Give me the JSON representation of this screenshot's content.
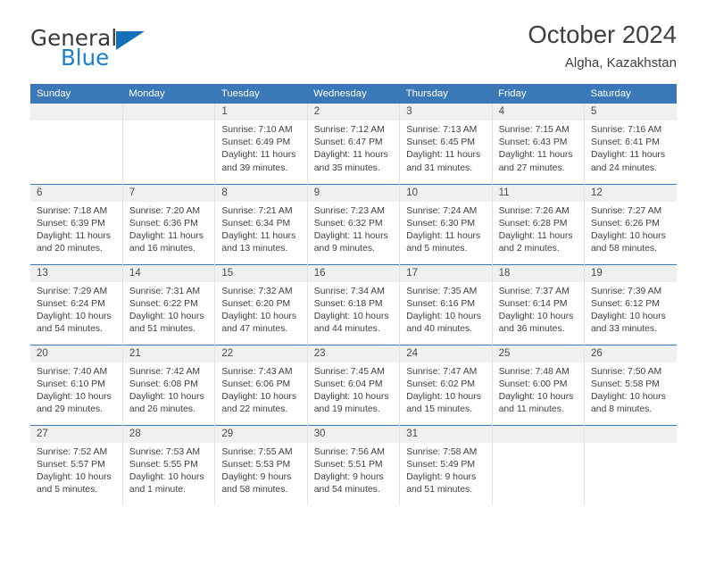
{
  "brand": {
    "word_one": "General",
    "word_two": "Blue",
    "triangle_color": "#1271b8",
    "blue_color": "#1b7fd1"
  },
  "header": {
    "title": "October 2024",
    "subtitle": "Algha, Kazakhstan"
  },
  "theme": {
    "header_blue": "#3b78b7",
    "daynum_background": "#f0f0f0",
    "grid_line": "#e3e3e3",
    "text": "#3f3f3f"
  },
  "weekdays": [
    "Sunday",
    "Monday",
    "Tuesday",
    "Wednesday",
    "Thursday",
    "Friday",
    "Saturday"
  ],
  "weeks": [
    [
      {
        "day": ""
      },
      {
        "day": ""
      },
      {
        "day": "1",
        "sunrise": "Sunrise: 7:10 AM",
        "sunset": "Sunset: 6:49 PM",
        "daylight_1": "Daylight: 11 hours",
        "daylight_2": "and 39 minutes."
      },
      {
        "day": "2",
        "sunrise": "Sunrise: 7:12 AM",
        "sunset": "Sunset: 6:47 PM",
        "daylight_1": "Daylight: 11 hours",
        "daylight_2": "and 35 minutes."
      },
      {
        "day": "3",
        "sunrise": "Sunrise: 7:13 AM",
        "sunset": "Sunset: 6:45 PM",
        "daylight_1": "Daylight: 11 hours",
        "daylight_2": "and 31 minutes."
      },
      {
        "day": "4",
        "sunrise": "Sunrise: 7:15 AM",
        "sunset": "Sunset: 6:43 PM",
        "daylight_1": "Daylight: 11 hours",
        "daylight_2": "and 27 minutes."
      },
      {
        "day": "5",
        "sunrise": "Sunrise: 7:16 AM",
        "sunset": "Sunset: 6:41 PM",
        "daylight_1": "Daylight: 11 hours",
        "daylight_2": "and 24 minutes."
      }
    ],
    [
      {
        "day": "6",
        "sunrise": "Sunrise: 7:18 AM",
        "sunset": "Sunset: 6:39 PM",
        "daylight_1": "Daylight: 11 hours",
        "daylight_2": "and 20 minutes."
      },
      {
        "day": "7",
        "sunrise": "Sunrise: 7:20 AM",
        "sunset": "Sunset: 6:36 PM",
        "daylight_1": "Daylight: 11 hours",
        "daylight_2": "and 16 minutes."
      },
      {
        "day": "8",
        "sunrise": "Sunrise: 7:21 AM",
        "sunset": "Sunset: 6:34 PM",
        "daylight_1": "Daylight: 11 hours",
        "daylight_2": "and 13 minutes."
      },
      {
        "day": "9",
        "sunrise": "Sunrise: 7:23 AM",
        "sunset": "Sunset: 6:32 PM",
        "daylight_1": "Daylight: 11 hours",
        "daylight_2": "and 9 minutes."
      },
      {
        "day": "10",
        "sunrise": "Sunrise: 7:24 AM",
        "sunset": "Sunset: 6:30 PM",
        "daylight_1": "Daylight: 11 hours",
        "daylight_2": "and 5 minutes."
      },
      {
        "day": "11",
        "sunrise": "Sunrise: 7:26 AM",
        "sunset": "Sunset: 6:28 PM",
        "daylight_1": "Daylight: 11 hours",
        "daylight_2": "and 2 minutes."
      },
      {
        "day": "12",
        "sunrise": "Sunrise: 7:27 AM",
        "sunset": "Sunset: 6:26 PM",
        "daylight_1": "Daylight: 10 hours",
        "daylight_2": "and 58 minutes."
      }
    ],
    [
      {
        "day": "13",
        "sunrise": "Sunrise: 7:29 AM",
        "sunset": "Sunset: 6:24 PM",
        "daylight_1": "Daylight: 10 hours",
        "daylight_2": "and 54 minutes."
      },
      {
        "day": "14",
        "sunrise": "Sunrise: 7:31 AM",
        "sunset": "Sunset: 6:22 PM",
        "daylight_1": "Daylight: 10 hours",
        "daylight_2": "and 51 minutes."
      },
      {
        "day": "15",
        "sunrise": "Sunrise: 7:32 AM",
        "sunset": "Sunset: 6:20 PM",
        "daylight_1": "Daylight: 10 hours",
        "daylight_2": "and 47 minutes."
      },
      {
        "day": "16",
        "sunrise": "Sunrise: 7:34 AM",
        "sunset": "Sunset: 6:18 PM",
        "daylight_1": "Daylight: 10 hours",
        "daylight_2": "and 44 minutes."
      },
      {
        "day": "17",
        "sunrise": "Sunrise: 7:35 AM",
        "sunset": "Sunset: 6:16 PM",
        "daylight_1": "Daylight: 10 hours",
        "daylight_2": "and 40 minutes."
      },
      {
        "day": "18",
        "sunrise": "Sunrise: 7:37 AM",
        "sunset": "Sunset: 6:14 PM",
        "daylight_1": "Daylight: 10 hours",
        "daylight_2": "and 36 minutes."
      },
      {
        "day": "19",
        "sunrise": "Sunrise: 7:39 AM",
        "sunset": "Sunset: 6:12 PM",
        "daylight_1": "Daylight: 10 hours",
        "daylight_2": "and 33 minutes."
      }
    ],
    [
      {
        "day": "20",
        "sunrise": "Sunrise: 7:40 AM",
        "sunset": "Sunset: 6:10 PM",
        "daylight_1": "Daylight: 10 hours",
        "daylight_2": "and 29 minutes."
      },
      {
        "day": "21",
        "sunrise": "Sunrise: 7:42 AM",
        "sunset": "Sunset: 6:08 PM",
        "daylight_1": "Daylight: 10 hours",
        "daylight_2": "and 26 minutes."
      },
      {
        "day": "22",
        "sunrise": "Sunrise: 7:43 AM",
        "sunset": "Sunset: 6:06 PM",
        "daylight_1": "Daylight: 10 hours",
        "daylight_2": "and 22 minutes."
      },
      {
        "day": "23",
        "sunrise": "Sunrise: 7:45 AM",
        "sunset": "Sunset: 6:04 PM",
        "daylight_1": "Daylight: 10 hours",
        "daylight_2": "and 19 minutes."
      },
      {
        "day": "24",
        "sunrise": "Sunrise: 7:47 AM",
        "sunset": "Sunset: 6:02 PM",
        "daylight_1": "Daylight: 10 hours",
        "daylight_2": "and 15 minutes."
      },
      {
        "day": "25",
        "sunrise": "Sunrise: 7:48 AM",
        "sunset": "Sunset: 6:00 PM",
        "daylight_1": "Daylight: 10 hours",
        "daylight_2": "and 11 minutes."
      },
      {
        "day": "26",
        "sunrise": "Sunrise: 7:50 AM",
        "sunset": "Sunset: 5:58 PM",
        "daylight_1": "Daylight: 10 hours",
        "daylight_2": "and 8 minutes."
      }
    ],
    [
      {
        "day": "27",
        "sunrise": "Sunrise: 7:52 AM",
        "sunset": "Sunset: 5:57 PM",
        "daylight_1": "Daylight: 10 hours",
        "daylight_2": "and 5 minutes."
      },
      {
        "day": "28",
        "sunrise": "Sunrise: 7:53 AM",
        "sunset": "Sunset: 5:55 PM",
        "daylight_1": "Daylight: 10 hours",
        "daylight_2": "and 1 minute."
      },
      {
        "day": "29",
        "sunrise": "Sunrise: 7:55 AM",
        "sunset": "Sunset: 5:53 PM",
        "daylight_1": "Daylight: 9 hours",
        "daylight_2": "and 58 minutes."
      },
      {
        "day": "30",
        "sunrise": "Sunrise: 7:56 AM",
        "sunset": "Sunset: 5:51 PM",
        "daylight_1": "Daylight: 9 hours",
        "daylight_2": "and 54 minutes."
      },
      {
        "day": "31",
        "sunrise": "Sunrise: 7:58 AM",
        "sunset": "Sunset: 5:49 PM",
        "daylight_1": "Daylight: 9 hours",
        "daylight_2": "and 51 minutes."
      },
      {
        "day": ""
      },
      {
        "day": ""
      }
    ]
  ]
}
